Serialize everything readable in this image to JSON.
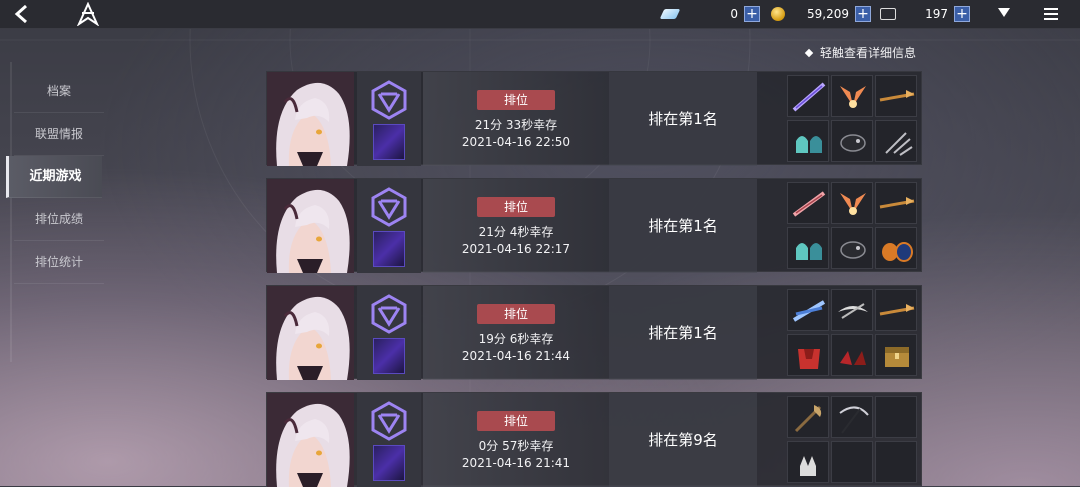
{
  "topbar": {
    "gems": "0",
    "gold": "59,209",
    "tickets": "197",
    "plus": "+"
  },
  "hint": "轻触查看详细信息",
  "sidebar": {
    "items": [
      {
        "label": "档案"
      },
      {
        "label": "联盟情报"
      },
      {
        "label": "近期游戏",
        "active": true
      },
      {
        "label": "排位成绩"
      },
      {
        "label": "排位统计"
      }
    ]
  },
  "matches": [
    {
      "badge": "排位",
      "survive": "21分 33秒幸存",
      "date": "2021-04-16 22:50",
      "rank": "排在第1名",
      "items": [
        "purple-blade",
        "orange-wings",
        "gold-staff",
        "teal-armor",
        "dark-gauntlet",
        "dark-claw"
      ]
    },
    {
      "badge": "排位",
      "survive": "21分 4秒幸存",
      "date": "2021-04-16 22:17",
      "rank": "排在第1名",
      "items": [
        "pink-blade",
        "orange-wings",
        "gold-staff",
        "teal-armor",
        "dark-gauntlet",
        "orange-boots"
      ]
    },
    {
      "badge": "排位",
      "survive": "19分 6秒幸存",
      "date": "2021-04-16 21:44",
      "rank": "排在第1名",
      "items": [
        "blue-blade",
        "silver-wings",
        "gold-staff",
        "red-armor",
        "red-boots",
        "treasure-box"
      ]
    },
    {
      "badge": "排位",
      "survive": "0分 57秒幸存",
      "date": "2021-04-16 21:41",
      "rank": "排在第9名",
      "items": [
        "brown-axe",
        "dark-scythe",
        "empty",
        "silver-glove",
        "empty",
        "empty"
      ]
    }
  ],
  "colors": {
    "badge": "#a94a4f",
    "emblem": "#9d84f2",
    "plus": "#3b5fa8"
  }
}
